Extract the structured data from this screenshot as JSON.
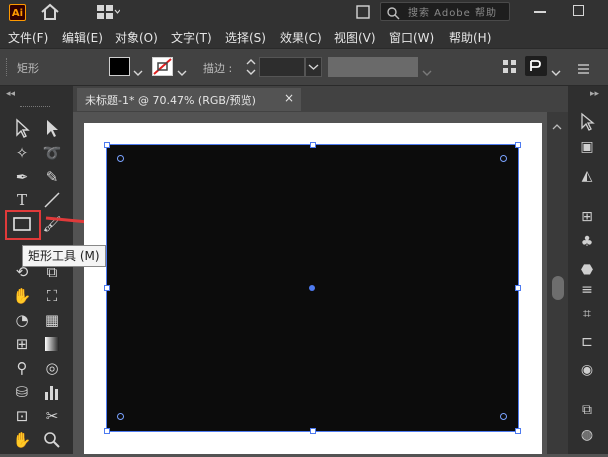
{
  "titlebar": {
    "logo": "Ai",
    "search_placeholder": "搜索 Adobe 帮助",
    "icons": [
      "home-icon",
      "layout-grid-icon",
      "share-icon",
      "minimize-icon",
      "restore-icon"
    ]
  },
  "menu": [
    "文件(F)",
    "编辑(E)",
    "对象(O)",
    "文字(T)",
    "选择(S)",
    "效果(C)",
    "视图(V)",
    "窗口(W)",
    "帮助(H)"
  ],
  "control": {
    "shape_label": "矩形",
    "stroke_label": "描边 :",
    "fill_color": "#000000"
  },
  "document": {
    "tab_title": "未标题-1* @ 70.47% (RGB/预览)",
    "close": "×"
  },
  "tooltip": "矩形工具 (M)",
  "colors": {
    "accent": "#4e7bf0",
    "highlight": "#e03a3a",
    "rect_fill": "#0c0c0c"
  }
}
